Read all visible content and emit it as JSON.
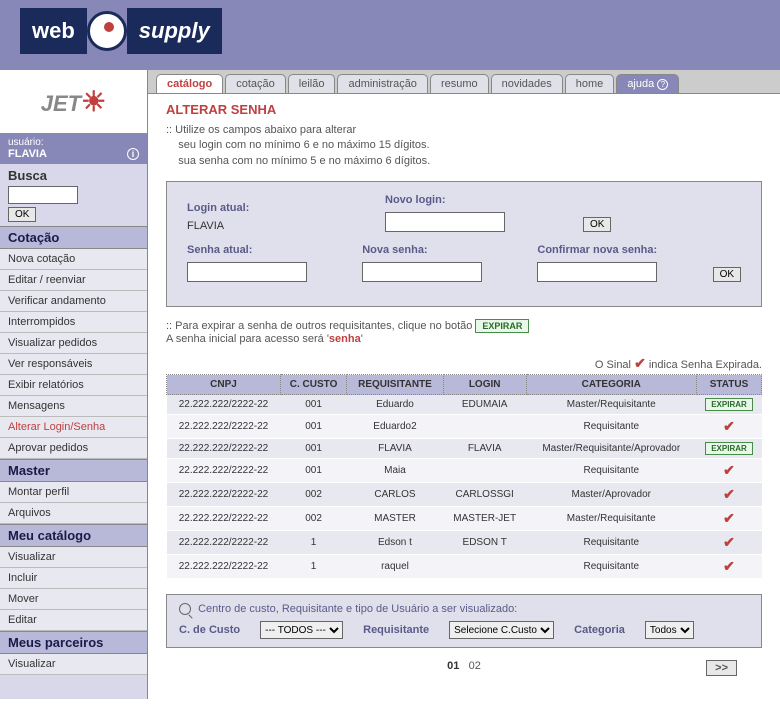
{
  "logo": {
    "web": "web",
    "supply": "supply"
  },
  "user": {
    "label": "usuário:",
    "name": "FLAVIA"
  },
  "search": {
    "title": "Busca",
    "ok": "OK"
  },
  "sidebar": {
    "sections": [
      {
        "title": "Cotação",
        "items": [
          "Nova cotação",
          "Editar / reenviar",
          "Verificar andamento",
          "Interrompidos",
          "Visualizar pedidos",
          "Ver responsáveis",
          "Exibir relatórios",
          "Mensagens",
          "Alterar Login/Senha",
          "Aprovar pedidos"
        ],
        "active": 8
      },
      {
        "title": "Master",
        "items": [
          "Montar perfil",
          "Arquivos"
        ]
      },
      {
        "title": "Meu catálogo",
        "items": [
          "Visualizar",
          "Incluir",
          "Mover",
          "Editar"
        ]
      },
      {
        "title": "Meus parceiros",
        "items": [
          "Visualizar"
        ]
      }
    ]
  },
  "tabs": {
    "items": [
      "catálogo",
      "cotação",
      "leilão",
      "administração",
      "resumo",
      "novidades",
      "home"
    ],
    "help": "ajuda",
    "active": 0
  },
  "page": {
    "title": "ALTERAR SENHA",
    "intro1": ":: Utilize os campos abaixo para alterar",
    "intro2": "seu login com no mínimo 6 e no máximo 15 dígitos.",
    "intro3": "sua senha com no mínimo 5 e no máximo 6 dígitos."
  },
  "form": {
    "login_atual_label": "Login atual:",
    "login_atual_value": "FLAVIA",
    "novo_login_label": "Novo login:",
    "ok": "OK",
    "senha_atual_label": "Senha atual:",
    "nova_senha_label": "Nova senha:",
    "confirmar_label": "Confirmar nova senha:"
  },
  "hint": {
    "line1_a": ":: Para expirar a senha de outros requisitantes, clique no botão",
    "expire": "EXPIRAR",
    "line2_a": "A senha inicial para acesso será '",
    "senha": "senha",
    "line2_b": "'"
  },
  "legend": {
    "prefix": "O Sinal",
    "suffix": "indica Senha Expirada."
  },
  "table": {
    "headers": [
      "CNPJ",
      "C. CUSTO",
      "REQUISITANTE",
      "LOGIN",
      "CATEGORIA",
      "STATUS"
    ],
    "rows": [
      {
        "cnpj": "22.222.222/2222-22",
        "custo": "001",
        "req": "Eduardo",
        "login": "EDUMAIA",
        "cat": "Master/Requisitante",
        "status": "expirar"
      },
      {
        "cnpj": "22.222.222/2222-22",
        "custo": "001",
        "req": "Eduardo2",
        "login": "",
        "cat": "Requisitante",
        "status": "check"
      },
      {
        "cnpj": "22.222.222/2222-22",
        "custo": "001",
        "req": "FLAVIA",
        "login": "FLAVIA",
        "cat": "Master/Requisitante/Aprovador",
        "status": "expirar"
      },
      {
        "cnpj": "22.222.222/2222-22",
        "custo": "001",
        "req": "Maia",
        "login": "",
        "cat": "Requisitante",
        "status": "check"
      },
      {
        "cnpj": "22.222.222/2222-22",
        "custo": "002",
        "req": "CARLOS",
        "login": "CARLOSSGI",
        "cat": "Master/Aprovador",
        "status": "check"
      },
      {
        "cnpj": "22.222.222/2222-22",
        "custo": "002",
        "req": "MASTER",
        "login": "MASTER-JET",
        "cat": "Master/Requisitante",
        "status": "check"
      },
      {
        "cnpj": "22.222.222/2222-22",
        "custo": "1",
        "req": "Edson t",
        "login": "EDSON T",
        "cat": "Requisitante",
        "status": "check"
      },
      {
        "cnpj": "22.222.222/2222-22",
        "custo": "1",
        "req": "raquel",
        "login": "",
        "cat": "Requisitante",
        "status": "check"
      }
    ],
    "expirar_label": "EXPIRAR"
  },
  "filter": {
    "title": "Centro de custo, Requisitante e tipo de Usuário a ser visualizado:",
    "custo_label": "C. de Custo",
    "custo_opt": "--- TODOS ---",
    "req_label": "Requisitante",
    "req_opt": "Selecione C.Custo",
    "cat_label": "Categoria",
    "cat_opt": "Todos"
  },
  "pager": {
    "p1": "01",
    "p2": "02",
    "next": ">>"
  }
}
